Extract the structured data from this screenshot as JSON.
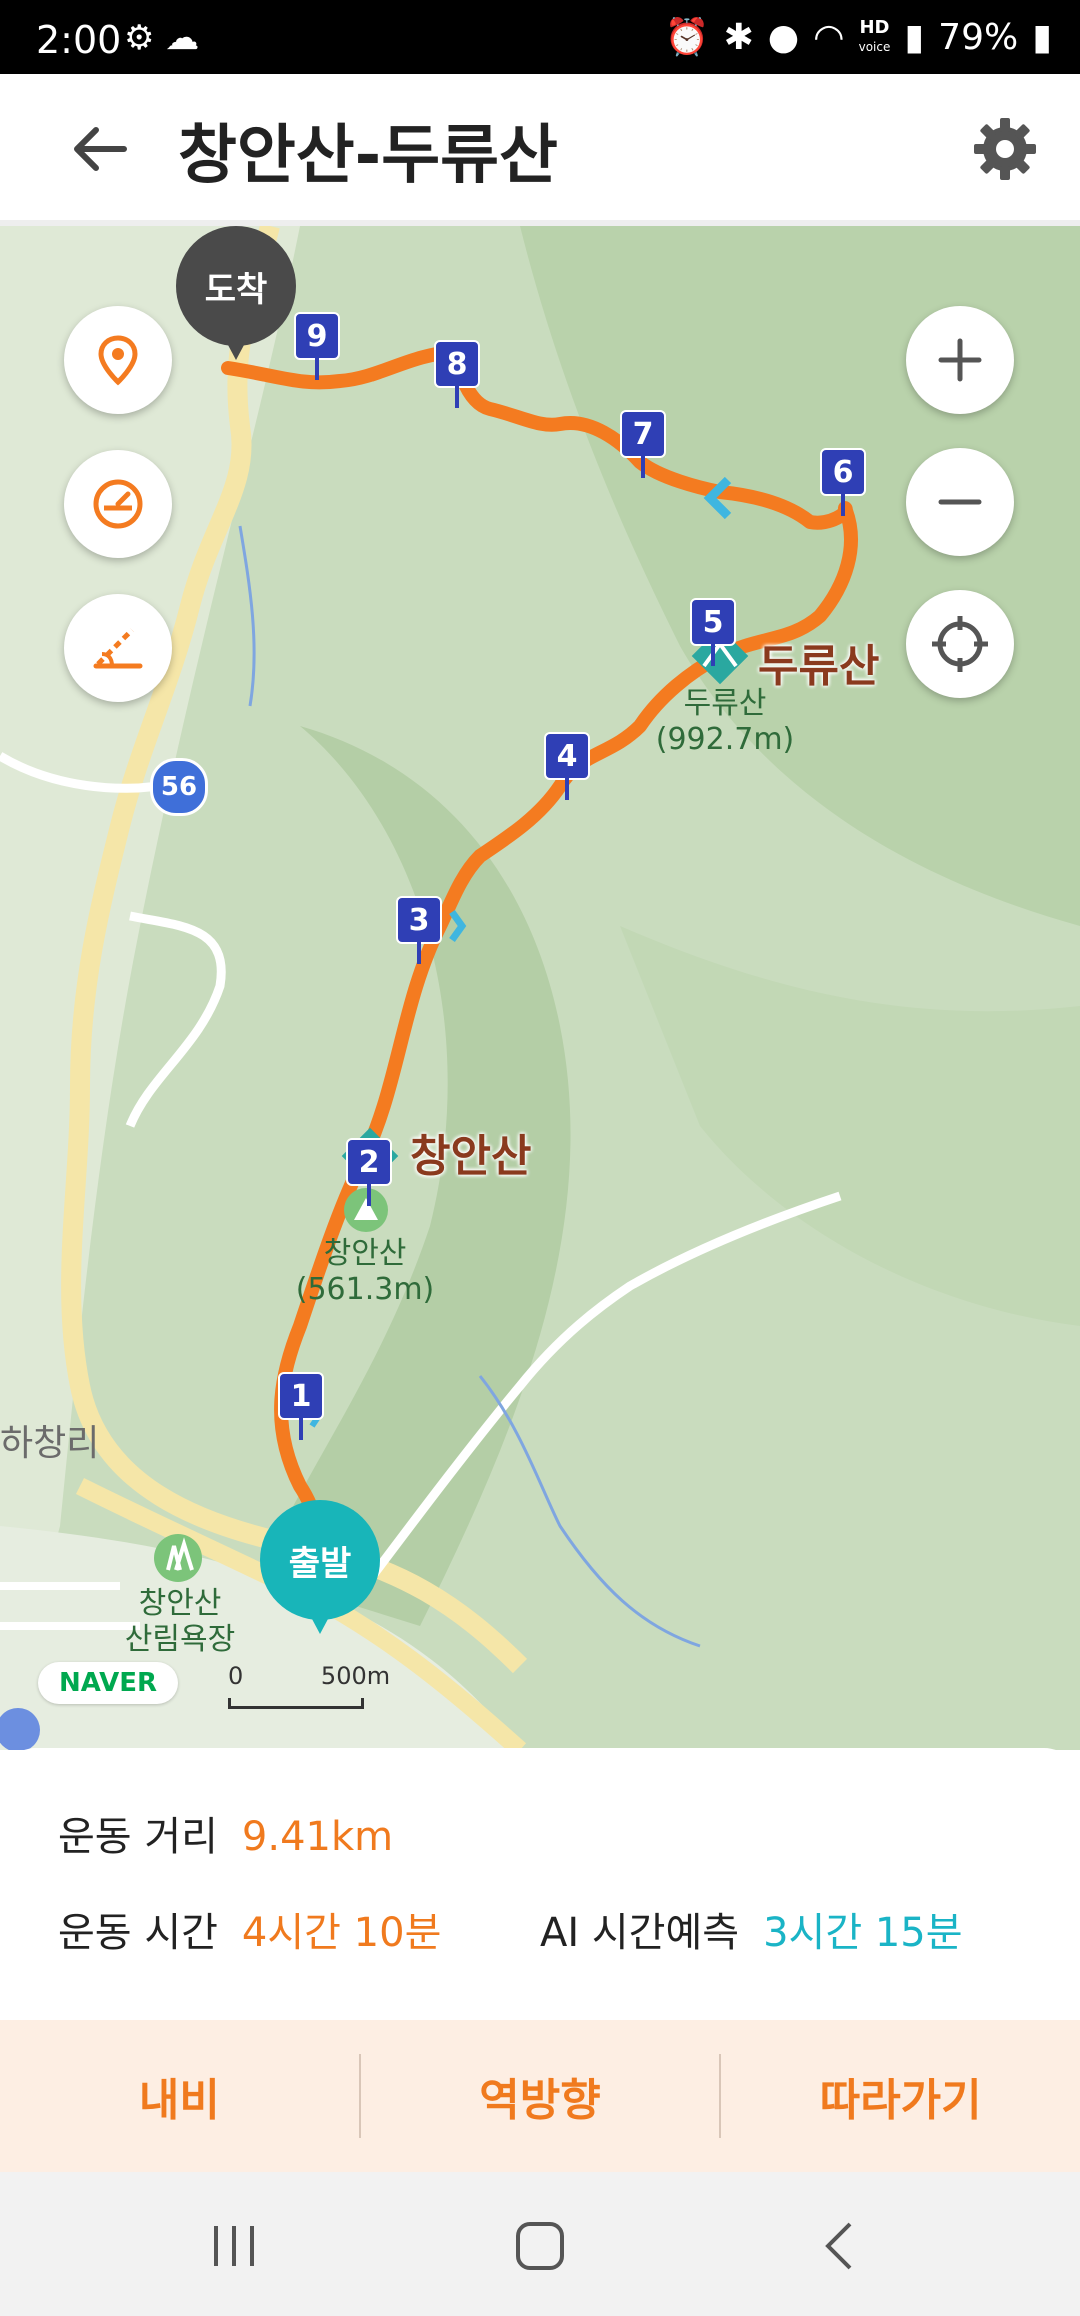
{
  "status_bar": {
    "time": "2:00",
    "hd_label": "HD",
    "hd_sub": "voice",
    "battery": "79%"
  },
  "app_bar": {
    "title": "창안산-두류산"
  },
  "map": {
    "end_pin": "도착",
    "start_pin": "출발",
    "waypoints": [
      "1",
      "2",
      "3",
      "4",
      "5",
      "6",
      "7",
      "8",
      "9"
    ],
    "peaks": [
      {
        "name": "두류산",
        "sub_name": "두류산",
        "elevation": "(992.7m)"
      },
      {
        "name": "창안산",
        "sub_name": "창안산",
        "elevation": "(561.3m)"
      }
    ],
    "town": "하창리",
    "forest": {
      "line1": "창안산",
      "line2": "산림욕장"
    },
    "road_number": "56",
    "naver_logo": "NAVER",
    "scale": {
      "zero": "0",
      "distance": "500m"
    },
    "route_color": "#f47b20"
  },
  "info": {
    "distance_label": "운동 거리",
    "distance_value": "9.41km",
    "time_label": "운동 시간",
    "time_value": "4시간 10분",
    "ai_label": "AI 시간예측",
    "ai_value": "3시간 15분"
  },
  "actions": {
    "navi": "내비",
    "reverse": "역방향",
    "follow": "따라가기"
  },
  "icons": {
    "back": "arrow-left-icon",
    "settings": "gear-icon",
    "location": "location-pin-icon",
    "speed": "speedometer-icon",
    "elevation": "elevation-slope-icon",
    "zoom_in": "plus-icon",
    "zoom_out": "minus-icon",
    "gps": "crosshair-icon"
  }
}
